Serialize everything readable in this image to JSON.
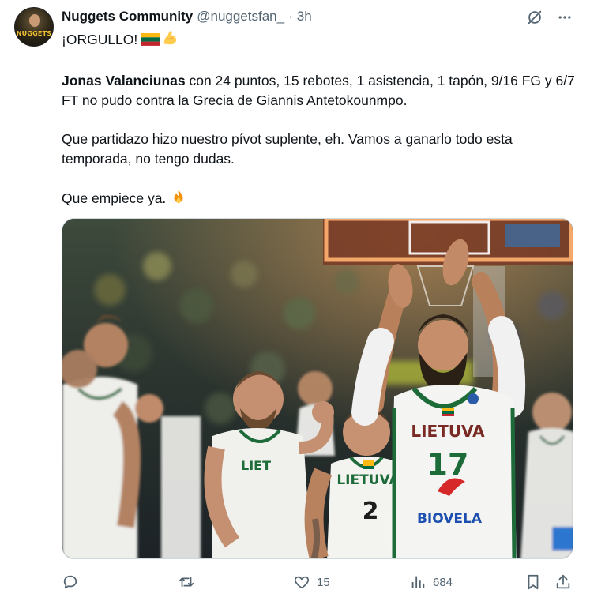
{
  "tweet": {
    "author_name": "Nuggets Community",
    "handle": "@nuggetsfan_",
    "separator": "·",
    "time": "3h",
    "avatar_text": "NUGGETS COMMUNITY",
    "line1": "¡ORGULLO!",
    "line1_emojis": [
      "flag-lithuania-icon",
      "flexed-biceps-icon"
    ],
    "para1_bold": "Jonas Valanciunas",
    "para1_rest": " con 24 puntos, 15 rebotes, 1 asistencia, 1 tapón, 9/16 FG y 6/7 FT no pudo contra la Grecia de Giannis Antetokounmpo.",
    "para2": "Que partidazo hizo nuestro pívot suplente, eh. Vamos a ganarlo todo esta temporada, no tengo dudas.",
    "para3": "Que empiece ya.",
    "para3_emoji": "fire-icon",
    "image_jersey_texts": [
      "LIETUVA",
      "17",
      "BIOVELA",
      "LIETUVA",
      "2"
    ],
    "actions": {
      "reply_count": "",
      "retweet_count": "",
      "like_count": "15",
      "views_count": "684"
    }
  },
  "colors": {
    "text_primary": "#0f1419",
    "text_secondary": "#536471",
    "border": "#cfd9de",
    "jersey_green": "#1e6b3a",
    "jersey_white": "#f4f4f2"
  }
}
